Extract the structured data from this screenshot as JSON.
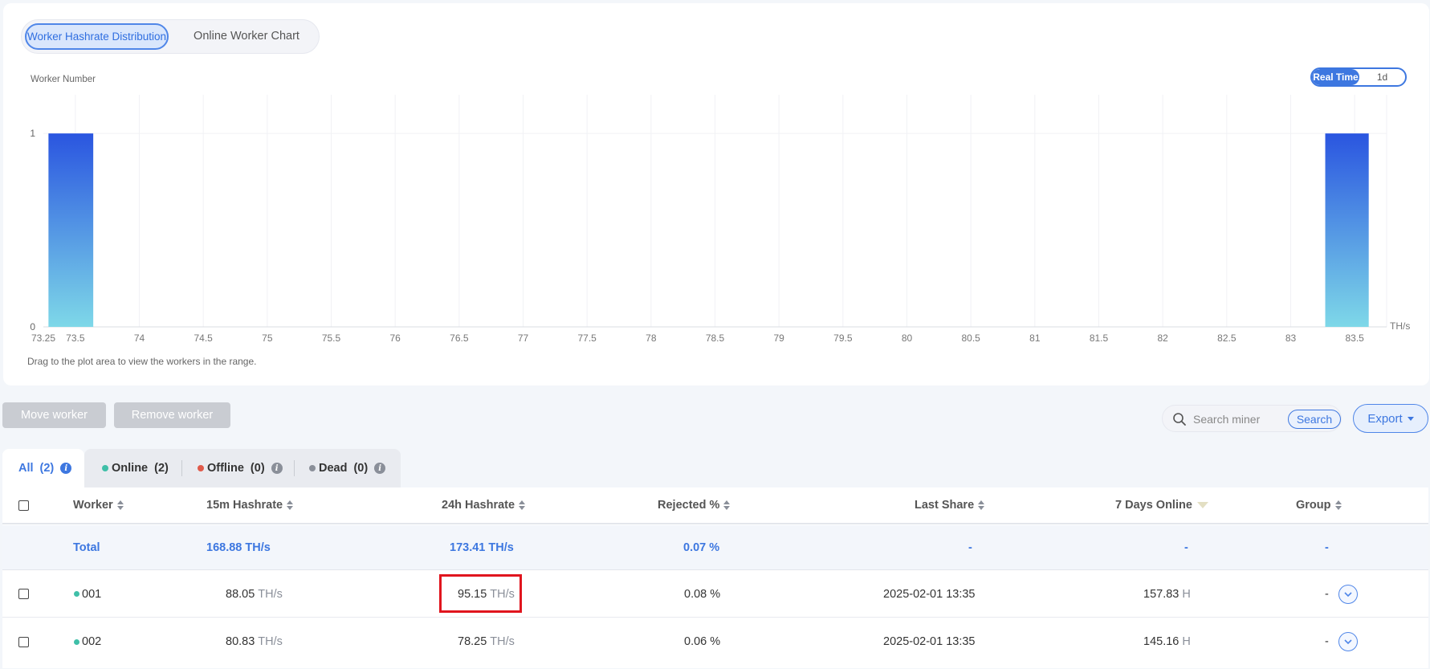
{
  "chart_tabs": {
    "active": "Worker Hashrate Distribution",
    "other": "Online Worker Chart"
  },
  "range_toggle": {
    "active": "Real Time",
    "other": "1d"
  },
  "chart_data": {
    "type": "bar",
    "ylabel": "Worker Number",
    "xunit": "TH/s",
    "xlim": [
      73.25,
      83.75
    ],
    "ylim": [
      0,
      1.2
    ],
    "yticks": [
      "0",
      "1"
    ],
    "xticks": [
      "73.25",
      "73.5",
      "74",
      "74.5",
      "75",
      "75.5",
      "76",
      "76.5",
      "77",
      "77.5",
      "78",
      "78.5",
      "79",
      "79.5",
      "80",
      "80.5",
      "81",
      "81.5",
      "82",
      "82.5",
      "83",
      "83.5"
    ],
    "bins": [
      {
        "x0": 73.29,
        "x1": 73.64,
        "value": 1
      },
      {
        "x0": 83.27,
        "x1": 83.61,
        "value": 1
      }
    ],
    "grid": true,
    "bar_gradient": [
      "#2a55e0",
      "#7ed8e8"
    ]
  },
  "chart_hint": "Drag to the plot area to view the workers in the range.",
  "toolbar": {
    "move_label": "Move worker",
    "remove_label": "Remove worker",
    "search_placeholder": "Search miner",
    "search_label": "Search",
    "export_label": "Export"
  },
  "tabs": {
    "all": {
      "label": "All",
      "count": "(2)"
    },
    "online": {
      "label": "Online",
      "count": "(2)"
    },
    "offline": {
      "label": "Offline",
      "count": "(0)"
    },
    "dead": {
      "label": "Dead",
      "count": "(0)"
    }
  },
  "colors": {
    "online": "#3fbfa8",
    "offline": "#e05a4a",
    "dead": "#8a8f99",
    "info": "#3d77e0",
    "info_gray": "#8a8f99"
  },
  "table": {
    "headers": {
      "worker": "Worker",
      "h15": "15m Hashrate",
      "h24": "24h Hashrate",
      "rejected": "Rejected %",
      "last_share": "Last Share",
      "online7": "7 Days Online",
      "group": "Group"
    },
    "total": {
      "label": "Total",
      "h15": "168.88 TH/s",
      "h24": "173.41 TH/s",
      "rejected": "0.07 %",
      "last_share": "-",
      "online7": "-",
      "group": "-"
    },
    "rows": [
      {
        "worker": "001",
        "h15": "88.05",
        "h15_unit": "TH/s",
        "h24": "95.15",
        "h24_unit": "TH/s",
        "rejected": "0.08 %",
        "last_share": "2025-02-01 13:35",
        "online7": "157.83",
        "online7_unit": "H",
        "group": "-"
      },
      {
        "worker": "002",
        "h15": "80.83",
        "h15_unit": "TH/s",
        "h24": "78.25",
        "h24_unit": "TH/s",
        "rejected": "0.06 %",
        "last_share": "2025-02-01 13:35",
        "online7": "145.16",
        "online7_unit": "H",
        "group": "-"
      }
    ]
  }
}
